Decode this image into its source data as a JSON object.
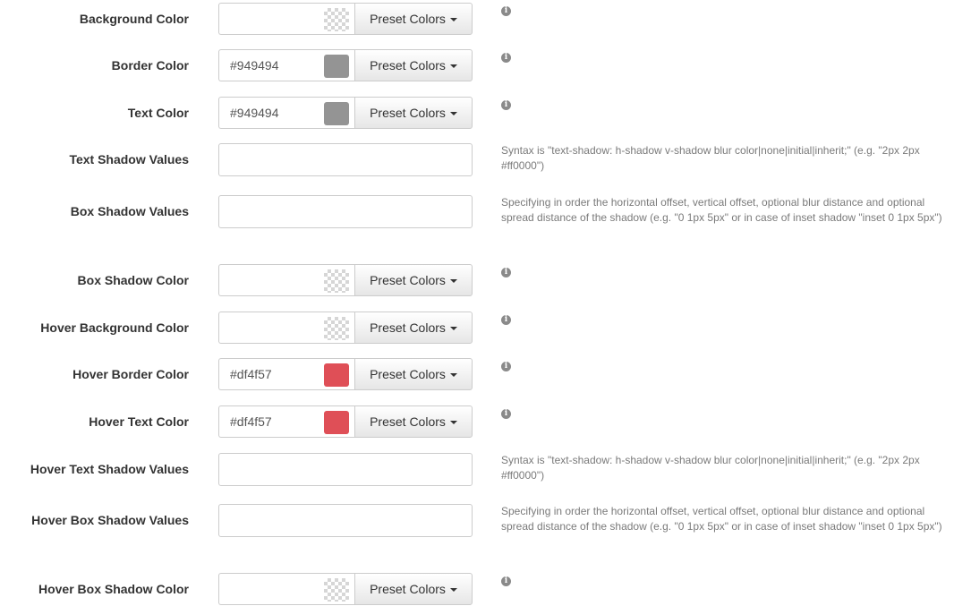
{
  "preset_button_label": "Preset Colors",
  "info_glyph": "i",
  "fields": {
    "background_color": {
      "label": "Background Color",
      "value": "",
      "swatch": null
    },
    "border_color": {
      "label": "Border Color",
      "value": "#949494",
      "swatch": "#949494"
    },
    "text_color": {
      "label": "Text Color",
      "value": "#949494",
      "swatch": "#949494"
    },
    "text_shadow_values": {
      "label": "Text Shadow Values",
      "value": "",
      "help": "Syntax is \"text-shadow: h-shadow v-shadow blur color|none|initial|inherit;\" (e.g. \"2px 2px #ff0000\")"
    },
    "box_shadow_values": {
      "label": "Box Shadow Values",
      "value": "",
      "help": "Specifying in order the horizontal offset, vertical offset, optional blur distance and optional spread distance of the shadow (e.g. \"0 1px 5px\" or in case of inset shadow \"inset 0 1px 5px\")"
    },
    "box_shadow_color": {
      "label": "Box Shadow Color",
      "value": "",
      "swatch": null
    },
    "hover_background_color": {
      "label": "Hover Background Color",
      "value": "",
      "swatch": null
    },
    "hover_border_color": {
      "label": "Hover Border Color",
      "value": "#df4f57",
      "swatch": "#df4f57"
    },
    "hover_text_color": {
      "label": "Hover Text Color",
      "value": "#df4f57",
      "swatch": "#df4f57"
    },
    "hover_text_shadow_values": {
      "label": "Hover Text Shadow Values",
      "value": "",
      "help": "Syntax is \"text-shadow: h-shadow v-shadow blur color|none|initial|inherit;\" (e.g. \"2px 2px #ff0000\")"
    },
    "hover_box_shadow_values": {
      "label": "Hover Box Shadow Values",
      "value": "",
      "help": "Specifying in order the horizontal offset, vertical offset, optional blur distance and optional spread distance of the shadow (e.g. \"0 1px 5px\" or in case of inset shadow \"inset 0 1px 5px\")"
    },
    "hover_box_shadow_color": {
      "label": "Hover Box Shadow Color",
      "value": "",
      "swatch": null
    }
  }
}
